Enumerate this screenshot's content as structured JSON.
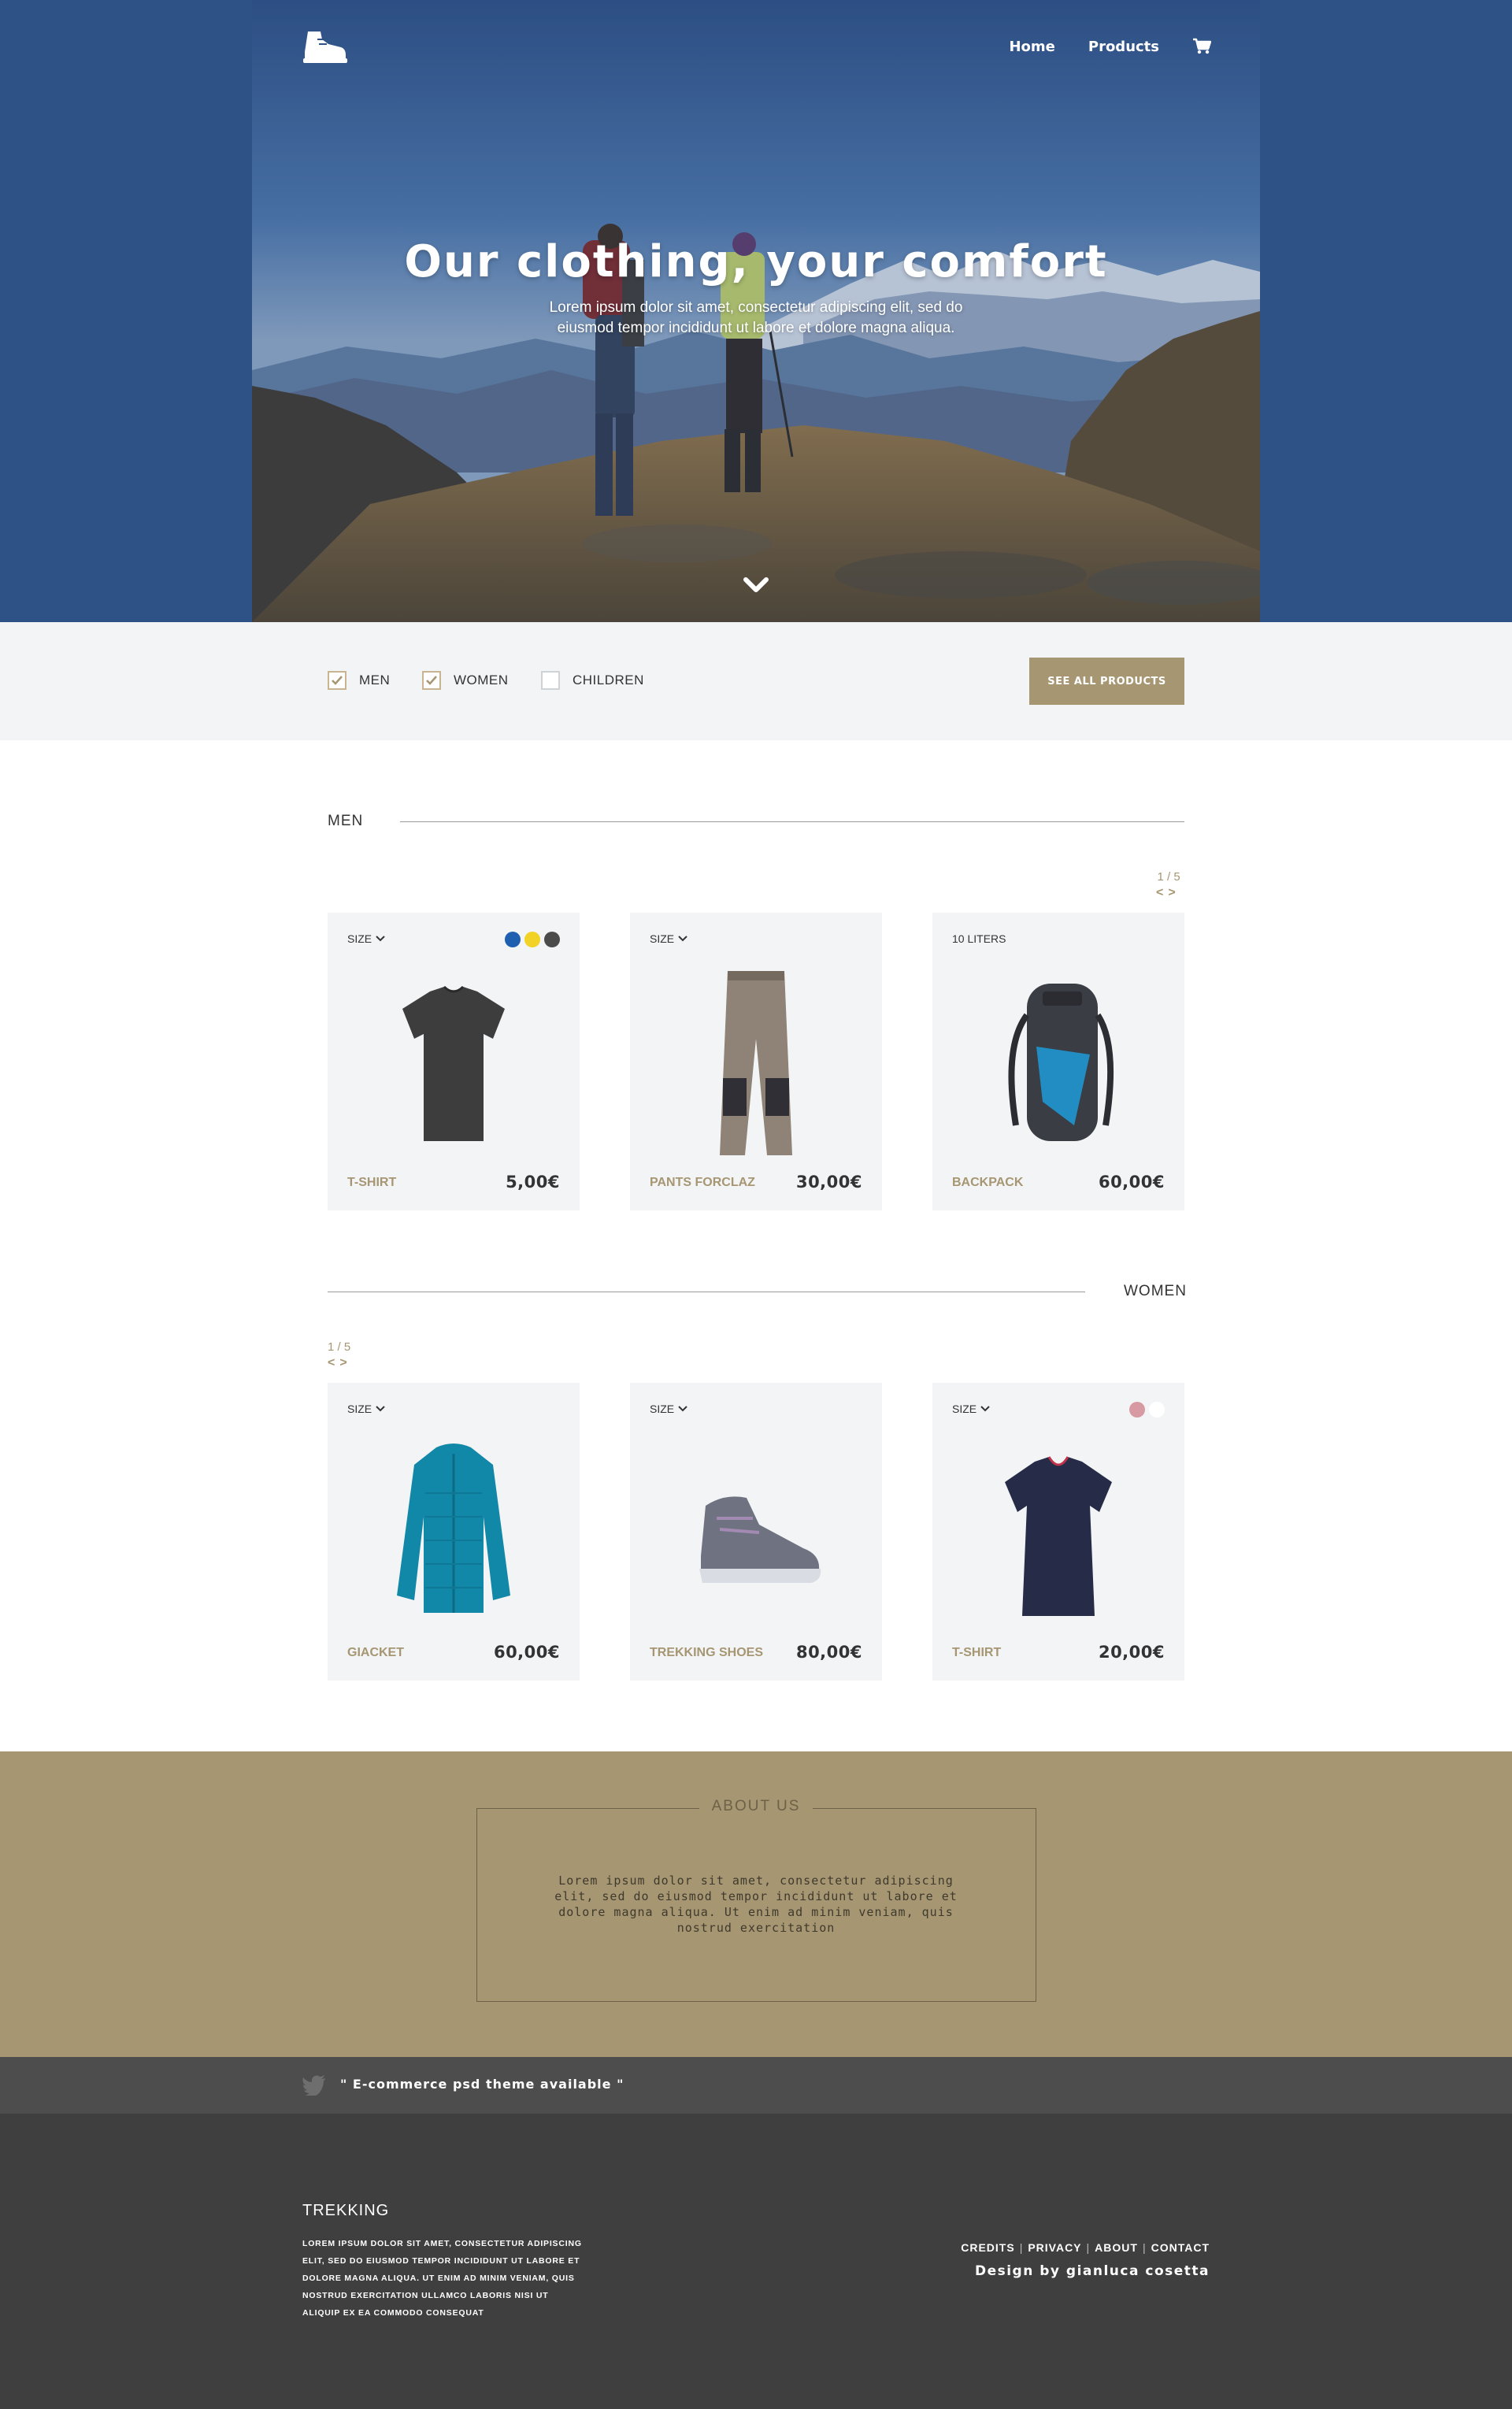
{
  "nav": {
    "items": [
      "Home",
      "Products"
    ],
    "logo_icon": "boot-icon",
    "cart_icon": "cart-icon"
  },
  "hero": {
    "title": "Our clothing, your comfort",
    "subtitle": "Lorem ipsum dolor sit amet, consectetur adipiscing elit, sed do eiusmod tempor incididunt ut labore et dolore magna aliqua."
  },
  "filters": [
    {
      "label": "MEN",
      "checked": true
    },
    {
      "label": "WOMEN",
      "checked": true
    },
    {
      "label": "CHILDREN",
      "checked": false
    }
  ],
  "see_all_label": "SEE ALL PRODUCTS",
  "sections": {
    "men": {
      "title": "MEN",
      "pager": "1 / 5",
      "products": [
        {
          "top_label": "SIZE",
          "name": "T-SHIRT",
          "price": "5,00€",
          "colors": [
            "#1f5fb0",
            "#f2d224",
            "#4b4b4b"
          ],
          "icon": "tshirt-icon"
        },
        {
          "top_label": "SIZE",
          "name": "PANTS FORCLAZ",
          "price": "30,00€",
          "colors": [],
          "icon": "pants-icon"
        },
        {
          "top_label": "10 LITERS",
          "name": "BACKPACK",
          "price": "60,00€",
          "colors": [],
          "icon": "backpack-icon"
        }
      ]
    },
    "women": {
      "title": "WOMEN",
      "pager": "1 / 5",
      "products": [
        {
          "top_label": "SIZE",
          "name": "GIACKET",
          "price": "60,00€",
          "colors": [],
          "icon": "jacket-icon"
        },
        {
          "top_label": "SIZE",
          "name": "TREKKING SHOES",
          "price": "80,00€",
          "colors": [],
          "icon": "shoe-icon"
        },
        {
          "top_label": "SIZE",
          "name": "T-SHIRT",
          "price": "20,00€",
          "colors": [
            "#d79aa2",
            "#ffffff"
          ],
          "icon": "tshirt-icon"
        }
      ]
    }
  },
  "about": {
    "title": "ABOUT US",
    "text": "Lorem ipsum dolor sit amet, consectetur adipiscing elit, sed do eiusmod tempor incididunt ut labore et dolore magna aliqua. Ut enim ad minim veniam, quis nostrud exercitation"
  },
  "tweet": {
    "text": "\" E-commerce psd theme available \"",
    "icon": "twitter-icon"
  },
  "footer": {
    "brand": "TREKKING",
    "text": "LOREM IPSUM DOLOR SIT AMET, CONSECTETUR ADIPISCING ELIT, SED DO EIUSMOD TEMPOR INCIDIDUNT UT LABORE ET DOLORE MAGNA ALIQUA. UT ENIM AD MINIM VENIAM, QUIS NOSTRUD EXERCITATION ULLAMCO LABORIS NISI UT ALIQUIP EX EA COMMODO CONSEQUAT",
    "links": [
      "CREDITS",
      "PRIVACY",
      "ABOUT",
      "CONTACT"
    ],
    "credit": "Design by gianluca cosetta"
  },
  "colors": {
    "accent": "#a69672",
    "hero_blue": "#2f5286",
    "light_bg": "#f3f4f6",
    "dark_footer": "#3f3f3f",
    "tweet_bar": "#4d4d4d"
  }
}
